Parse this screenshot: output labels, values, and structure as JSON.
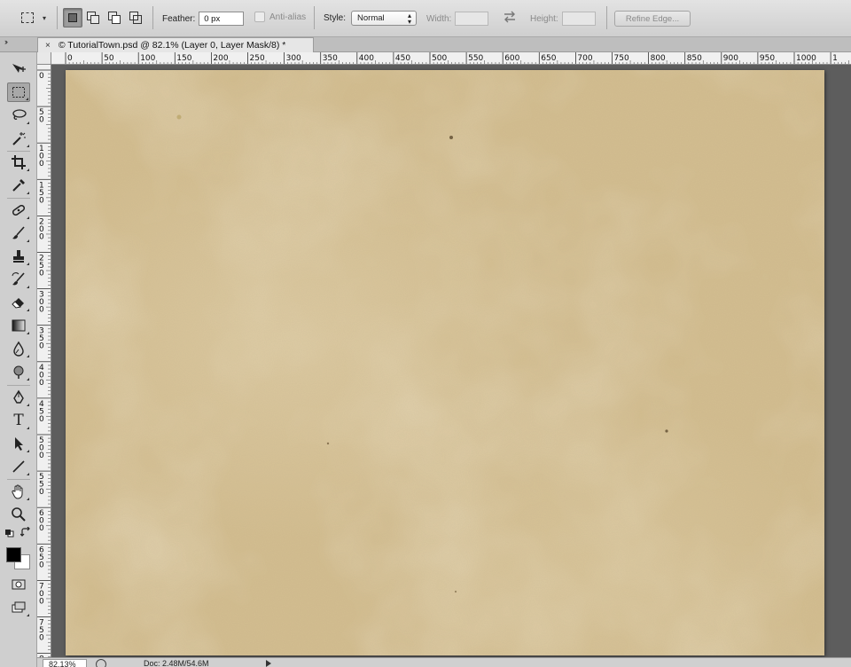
{
  "options_bar": {
    "tool_icon": "rectangular-marquee-icon",
    "selection_modes": [
      "new-selection-icon",
      "add-to-selection-icon",
      "subtract-from-selection-icon",
      "intersect-with-selection-icon"
    ],
    "feather_label": "Feather:",
    "feather_value": "0 px",
    "anti_alias_label": "Anti-alias",
    "style_label": "Style:",
    "style_value": "Normal",
    "width_label": "Width:",
    "width_value": "",
    "swap_icon": "swap-width-height-icon",
    "height_label": "Height:",
    "height_value": "",
    "refine_edge_label": "Refine Edge..."
  },
  "document_tab": {
    "close_glyph": "×",
    "title": "© TutorialTown.psd @ 82.1% (Layer 0, Layer Mask/8) *"
  },
  "toolbar": {
    "tools": [
      "move-tool-icon",
      "rectangular-marquee-tool-icon",
      "lasso-tool-icon",
      "magic-wand-tool-icon",
      "crop-tool-icon",
      "eyedropper-tool-icon",
      "spot-healing-brush-icon",
      "brush-tool-icon",
      "clone-stamp-tool-icon",
      "history-brush-icon",
      "eraser-tool-icon",
      "gradient-tool-icon",
      "blur-tool-icon",
      "dodge-tool-icon",
      "pen-tool-icon",
      "type-tool-icon",
      "path-selection-tool-icon",
      "line-tool-icon",
      "hand-tool-icon",
      "zoom-tool-icon",
      "default-colors-icon",
      "swap-colors-icon",
      "quick-mask-icon",
      "screen-mode-icon"
    ],
    "type_tool_glyph": "T",
    "foreground_color": "#000000",
    "background_color": "#ffffff"
  },
  "rulers": {
    "horizontal_labels": [
      "0",
      "50",
      "100",
      "150",
      "200",
      "250",
      "300",
      "350",
      "400",
      "450",
      "500",
      "550",
      "600",
      "650",
      "700",
      "750",
      "800",
      "850",
      "900",
      "950",
      "1000",
      "1"
    ],
    "vertical_labels": [
      "0",
      "50",
      "100",
      "150",
      "200",
      "250",
      "300",
      "350",
      "400",
      "450",
      "500",
      "550",
      "600",
      "650",
      "700",
      "750",
      "8"
    ]
  },
  "canvas": {
    "description_colors": [
      "#d3be90",
      "#c8ac76",
      "#ddcba3"
    ]
  },
  "status_bar": {
    "zoom_value": "82.13%",
    "doc_size": "Doc: 2.48M/54.6M"
  }
}
